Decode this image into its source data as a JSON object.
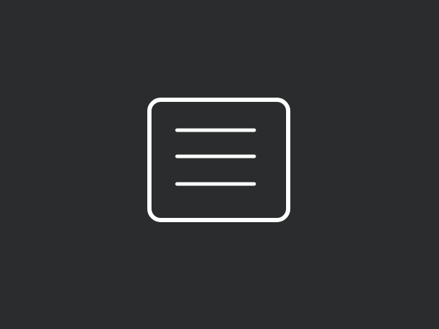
{
  "background_color": "#2b2c2d",
  "icon": {
    "name": "hamburger-menu-icon",
    "stroke_color": "#ffffff"
  }
}
